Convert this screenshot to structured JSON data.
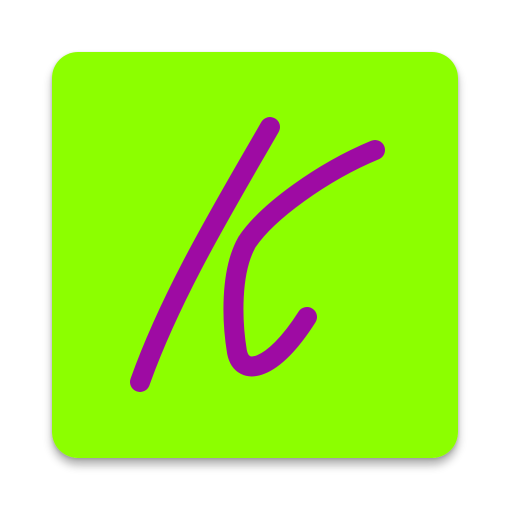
{
  "app_icon": {
    "background_color": "#8cff00",
    "glyph_color": "#9e0ba3",
    "glyph_name": "k-letter-icon"
  }
}
